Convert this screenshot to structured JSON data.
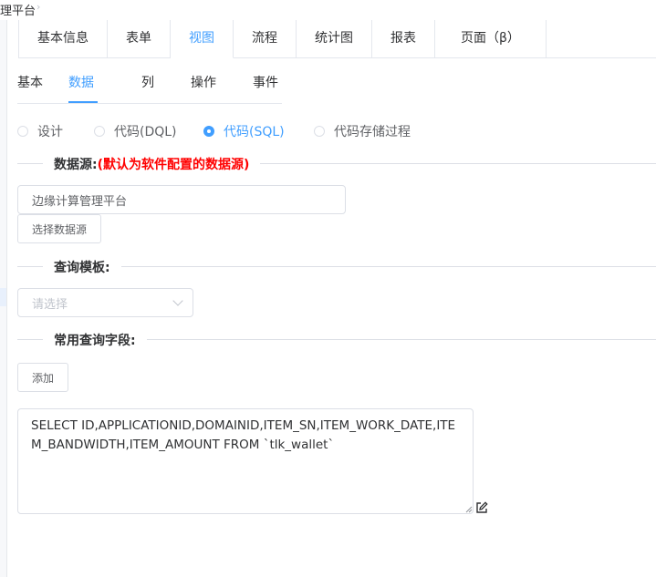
{
  "breadcrumb": {
    "current": "理平台",
    "separator": "›"
  },
  "card_tabs": [
    {
      "label": "基本信息",
      "active": false
    },
    {
      "label": "表单",
      "active": false
    },
    {
      "label": "视图",
      "active": true
    },
    {
      "label": "流程",
      "active": false
    },
    {
      "label": "统计图",
      "active": false
    },
    {
      "label": "报表",
      "active": false
    },
    {
      "label": "页面（β）",
      "active": false
    }
  ],
  "sub_tabs": [
    {
      "label": "基本",
      "active": false
    },
    {
      "label": "数据",
      "active": true
    },
    {
      "label": "列",
      "active": false
    },
    {
      "label": "操作",
      "active": false
    },
    {
      "label": "事件",
      "active": false
    }
  ],
  "mode_options": [
    {
      "label": "设计",
      "checked": false
    },
    {
      "label": "代码(DQL)",
      "checked": false
    },
    {
      "label": "代码(SQL)",
      "checked": true
    },
    {
      "label": "代码存储过程",
      "checked": false
    }
  ],
  "datasource": {
    "title": "数据源:",
    "hint": "(默认为软件配置的数据源)",
    "value": "边缘计算管理平台",
    "select_button": "选择数据源"
  },
  "query_template": {
    "title": "查询模板:",
    "placeholder": "请选择"
  },
  "common_fields": {
    "title": "常用查询字段:",
    "add_button": "添加"
  },
  "sql": "SELECT ID,APPLICATIONID,DOMAINID,ITEM_SN,ITEM_WORK_DATE,ITEM_BANDWIDTH,ITEM_AMOUNT FROM `tlk_wallet`",
  "colors": {
    "accent": "#409eff",
    "hint": "#ff0000",
    "border": "#dcdfe6"
  }
}
